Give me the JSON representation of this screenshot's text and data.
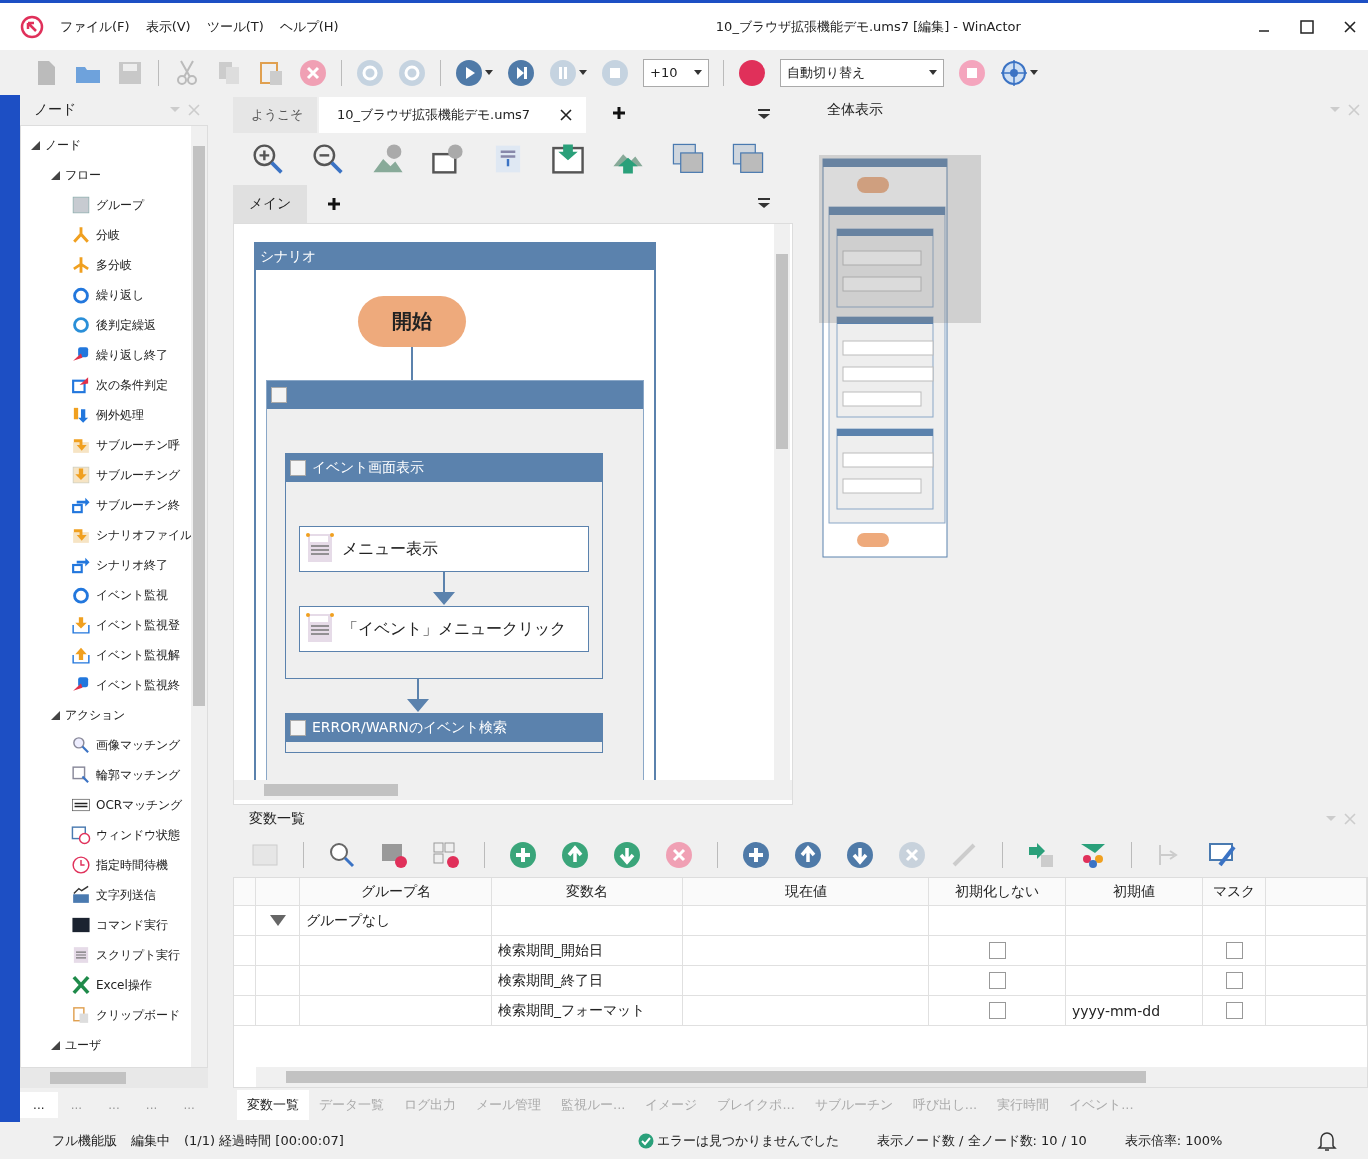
{
  "window": {
    "title": "10_ブラウザ拡張機能デモ.ums7 [編集] - WinActor",
    "menu": [
      "ファイル(F)",
      "表示(V)",
      "ツール(T)",
      "ヘルプ(H)"
    ]
  },
  "toolbar": {
    "step": "+10",
    "mode": "自動切り替え"
  },
  "node_panel": {
    "title": "ノード",
    "tree": [
      {
        "label": "ノード",
        "expanded": true,
        "children": [
          {
            "label": "フロー",
            "expanded": true,
            "children": [
              {
                "label": "グループ"
              },
              {
                "label": "分岐"
              },
              {
                "label": "多分岐"
              },
              {
                "label": "繰り返し"
              },
              {
                "label": "後判定繰返"
              },
              {
                "label": "繰り返し終了"
              },
              {
                "label": "次の条件判定"
              },
              {
                "label": "例外処理"
              },
              {
                "label": "サブルーチン呼"
              },
              {
                "label": "サブルーチング"
              },
              {
                "label": "サブルーチン終"
              },
              {
                "label": "シナリオファイル"
              },
              {
                "label": "シナリオ終了"
              },
              {
                "label": "イベント監視"
              },
              {
                "label": "イベント監視登"
              },
              {
                "label": "イベント監視解"
              },
              {
                "label": "イベント監視終"
              }
            ]
          },
          {
            "label": "アクション",
            "expanded": true,
            "children": [
              {
                "label": "画像マッチング"
              },
              {
                "label": "輪郭マッチング"
              },
              {
                "label": "OCRマッチング"
              },
              {
                "label": "ウィンドウ状態"
              },
              {
                "label": "指定時間待機"
              },
              {
                "label": "文字列送信"
              },
              {
                "label": "コマンド実行"
              },
              {
                "label": "スクリプト実行"
              },
              {
                "label": "Excel操作"
              },
              {
                "label": "クリップボード"
              }
            ]
          },
          {
            "label": "ユーザ",
            "expanded": true
          }
        ]
      }
    ],
    "bottom_tabs": [
      {
        "label": "...",
        "selected": true
      },
      {
        "label": "...",
        "selected": false
      },
      {
        "label": "...",
        "selected": false
      },
      {
        "label": "...",
        "selected": false
      },
      {
        "label": "...",
        "selected": false
      }
    ]
  },
  "editor": {
    "doc_tabs": [
      {
        "label": "ようこそ",
        "selected": false
      },
      {
        "label": "10_ブラウザ拡張機能デモ.ums7",
        "selected": true
      }
    ],
    "sheet_tabs": [
      {
        "label": "メイン",
        "selected": true
      }
    ],
    "scenario": {
      "title": "シナリオ",
      "start": "開始",
      "groups": [
        {
          "title": "イベント画面表示",
          "nodes": [
            "メニュー表示",
            "「イベント」メニュークリック"
          ]
        }
      ],
      "next_group": "ERROR/WARNのイベント検索"
    }
  },
  "overview": {
    "title": "全体表示"
  },
  "variables": {
    "title": "変数一覧",
    "columns": [
      "グループ名",
      "変数名",
      "現在値",
      "初期化しない",
      "初期値",
      "マスク"
    ],
    "group": {
      "label": "グループなし",
      "expanded": true
    },
    "rows": [
      {
        "name": "検索期間_開始日",
        "value": "",
        "no_init": false,
        "initial": "",
        "mask": false
      },
      {
        "name": "検索期間_終了日",
        "value": "",
        "no_init": false,
        "initial": "",
        "mask": false
      },
      {
        "name": "検索期間_フォーマット",
        "value": "",
        "no_init": false,
        "initial": "yyyy-mm-dd",
        "mask": false
      }
    ],
    "tabs": [
      {
        "label": "変数一覧",
        "selected": true
      },
      {
        "label": "データ一覧",
        "selected": false
      },
      {
        "label": "ログ出力",
        "selected": false
      },
      {
        "label": "メール管理",
        "selected": false
      },
      {
        "label": "監視ルー...",
        "selected": false
      },
      {
        "label": "イメージ",
        "selected": false
      },
      {
        "label": "ブレイクポ...",
        "selected": false
      },
      {
        "label": "サブルーチン",
        "selected": false
      },
      {
        "label": "呼び出し...",
        "selected": false
      },
      {
        "label": "実行時間",
        "selected": false
      },
      {
        "label": "イベント...",
        "selected": false
      }
    ]
  },
  "status_bar": {
    "edition": "フル機能版",
    "mode": "編集中",
    "elapsed": "(1/1) 経過時間 [00:00:07]",
    "check": "エラーは見つかりませんでした",
    "nodes": "表示ノード数 / 全ノード数: 10 / 10",
    "zoom": "表示倍率: 100%"
  }
}
